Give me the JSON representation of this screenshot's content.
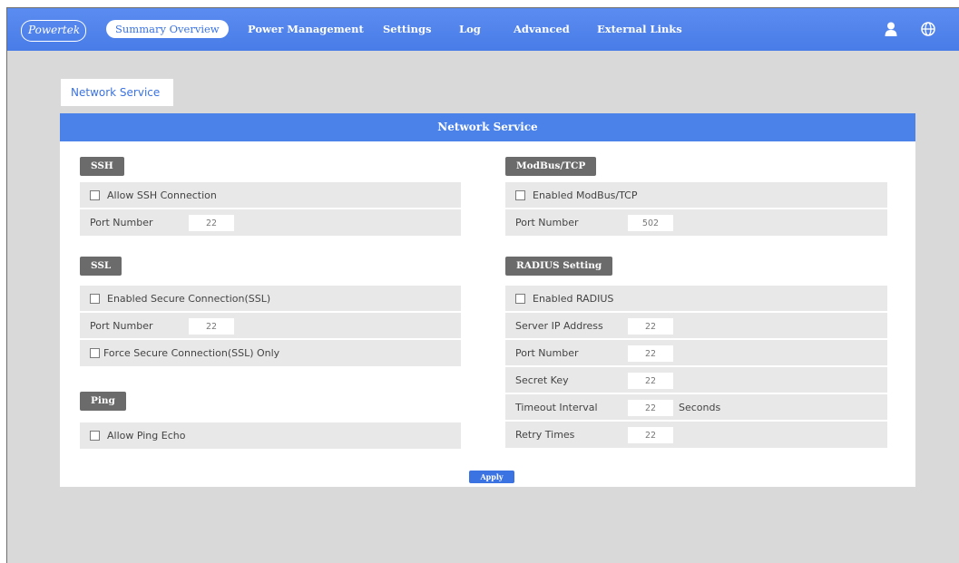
{
  "nav": {
    "logo": "Powertek",
    "items": [
      {
        "label": "Summary Overview"
      },
      {
        "label": "Power Management"
      },
      {
        "label": "Settings"
      },
      {
        "label": "Log"
      },
      {
        "label": "Advanced"
      },
      {
        "label": "External Links"
      }
    ],
    "icons": [
      "user-icon",
      "globe-icon"
    ]
  },
  "tab": {
    "label": "Network Service"
  },
  "panel": {
    "title": "Network Service",
    "ssh": {
      "heading": "SSH",
      "allow_label": "Allow SSH Connection",
      "port_label": "Port Number",
      "port_value": "22"
    },
    "ssl": {
      "heading": "SSL",
      "enable_label": "Enabled Secure Connection(SSL)",
      "port_label": "Port Number",
      "port_value": "22",
      "force_label": "Force Secure Connection(SSL) Only"
    },
    "ping": {
      "heading": "Ping",
      "allow_label": "Allow Ping Echo"
    },
    "modbus": {
      "heading": "ModBus/TCP",
      "enable_label": "Enabled ModBus/TCP",
      "port_label": "Port Number",
      "port_value": "502"
    },
    "radius": {
      "heading": "RADIUS Setting",
      "enable_label": "Enabled RADIUS",
      "server_label": "Server IP Address",
      "server_value": "22",
      "port_label": "Port Number",
      "port_value": "22",
      "secret_label": "Secret Key",
      "secret_value": "22",
      "timeout_label": "Timeout Interval",
      "timeout_value": "22",
      "timeout_unit": "Seconds",
      "retry_label": "Retry Times",
      "retry_value": "22"
    },
    "apply_label": "Apply"
  },
  "colors": {
    "accent": "#4a82ea",
    "badge": "#6b6b6b",
    "row_bg": "#e8e8e8",
    "page_bg": "#d9d9d9"
  }
}
